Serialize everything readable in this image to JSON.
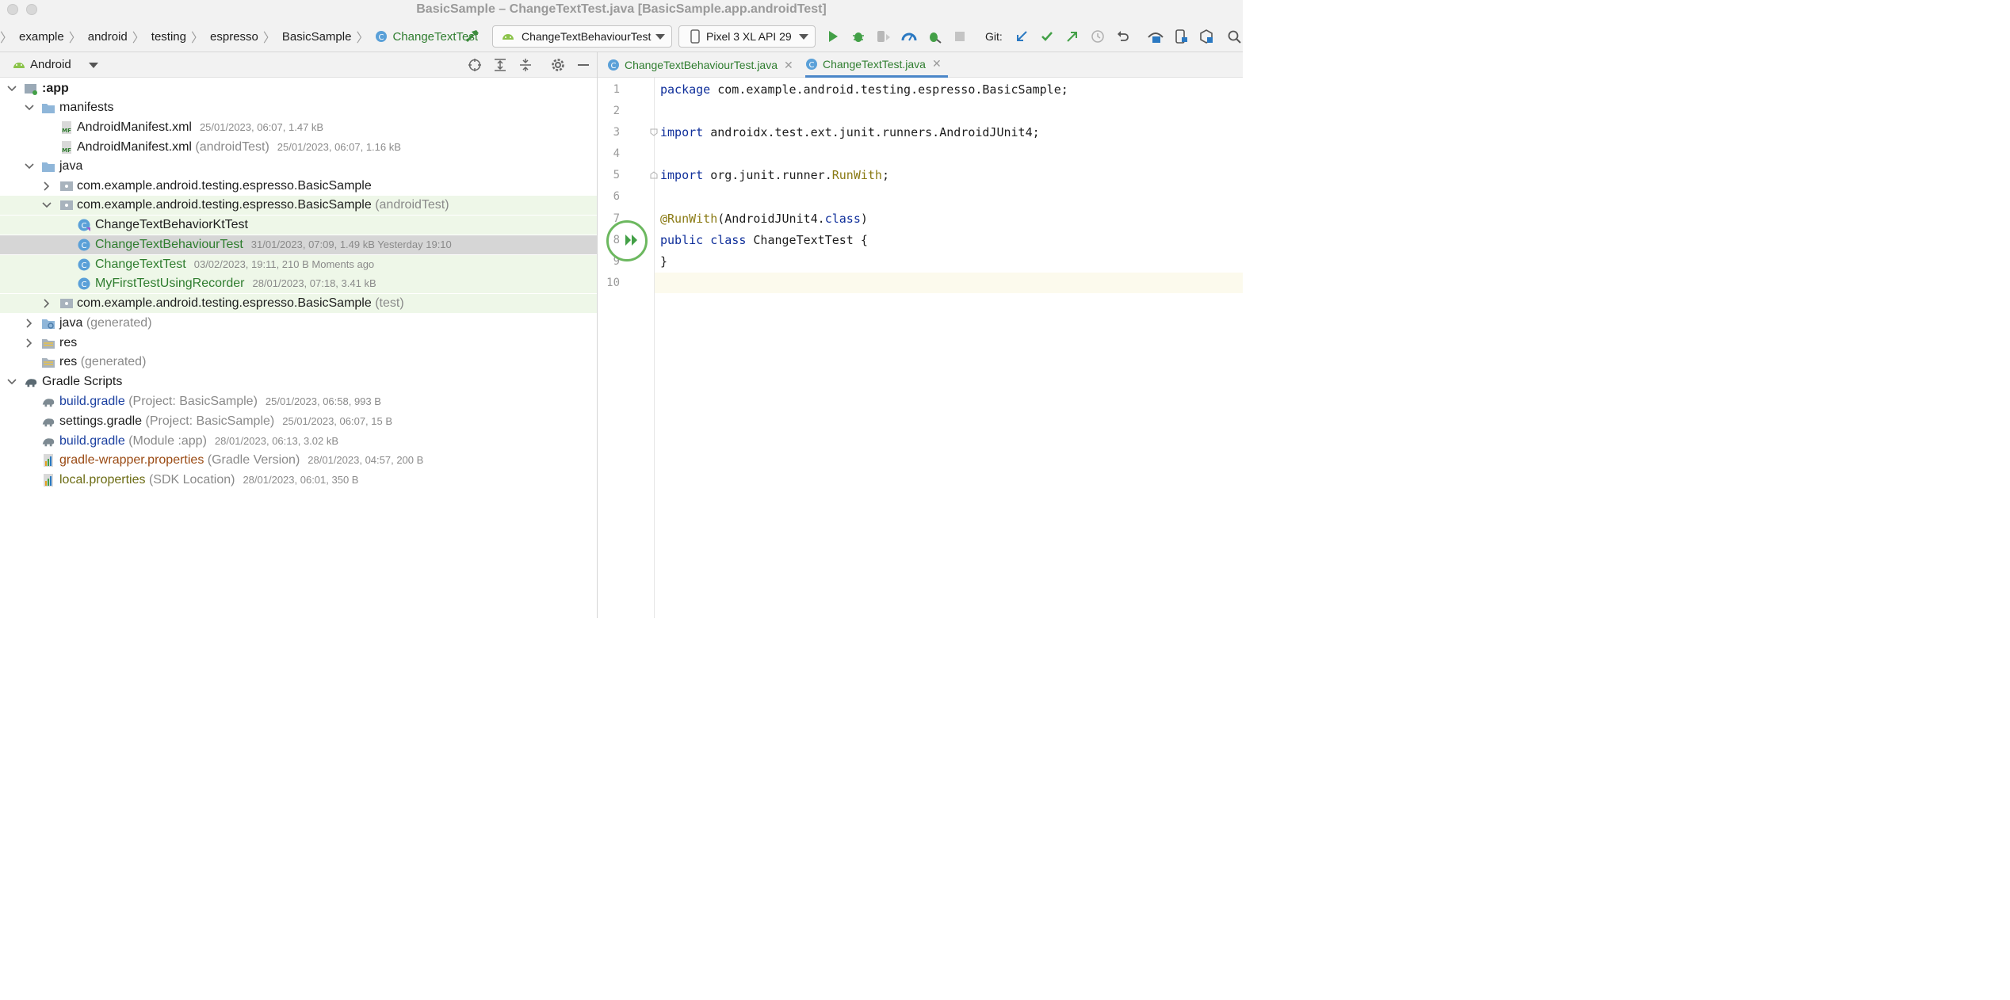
{
  "window": {
    "title": "BasicSample – ChangeTextTest.java [BasicSample.app.androidTest]"
  },
  "breadcrumb": [
    "example",
    "android",
    "testing",
    "espresso",
    "BasicSample",
    "ChangeTextTest"
  ],
  "toolbar": {
    "run_config": "ChangeTextBehaviourTest",
    "device": "Pixel 3 XL API 29",
    "git_label": "Git:"
  },
  "project_panel": {
    "view_mode": "Android"
  },
  "tree": {
    "app": ":app",
    "manifests": "manifests",
    "manifest1": {
      "name": "AndroidManifest.xml",
      "meta": "25/01/2023, 06:07, 1.47 kB"
    },
    "manifest2": {
      "name": "AndroidManifest.xml",
      "qual": "(androidTest)",
      "meta": "25/01/2023, 06:07, 1.16 kB"
    },
    "java": "java",
    "pkg_main": "com.example.android.testing.espresso.BasicSample",
    "pkg_android_test": {
      "name": "com.example.android.testing.espresso.BasicSample",
      "qual": "(androidTest)"
    },
    "file1": {
      "name": "ChangeTextBehaviorKtTest"
    },
    "file2": {
      "name": "ChangeTextBehaviourTest",
      "meta": "31/01/2023, 07:09, 1.49 kB Yesterday 19:10"
    },
    "file3": {
      "name": "ChangeTextTest",
      "meta": "03/02/2023, 19:11, 210 B Moments ago"
    },
    "file4": {
      "name": "MyFirstTestUsingRecorder",
      "meta": "28/01/2023, 07:18, 3.41 kB"
    },
    "pkg_test": {
      "name": "com.example.android.testing.espresso.BasicSample",
      "qual": "(test)"
    },
    "java_gen": {
      "name": "java",
      "qual": "(generated)"
    },
    "res": "res",
    "res_gen": {
      "name": "res",
      "qual": "(generated)"
    },
    "gradle_scripts": "Gradle Scripts",
    "g1": {
      "name": "build.gradle",
      "qual": "(Project: BasicSample)",
      "meta": "25/01/2023, 06:58, 993 B"
    },
    "g2": {
      "name": "settings.gradle",
      "qual": "(Project: BasicSample)",
      "meta": "25/01/2023, 06:07, 15 B"
    },
    "g3": {
      "name": "build.gradle",
      "qual": "(Module :app)",
      "meta": "28/01/2023, 06:13, 3.02 kB"
    },
    "g4": {
      "name": "gradle-wrapper.properties",
      "qual": "(Gradle Version)",
      "meta": "28/01/2023, 04:57, 200 B"
    },
    "g5": {
      "name": "local.properties",
      "qual": "(SDK Location)",
      "meta": "28/01/2023, 06:01, 350 B"
    }
  },
  "tabs": [
    {
      "label": "ChangeTextBehaviourTest.java"
    },
    {
      "label": "ChangeTextTest.java"
    }
  ],
  "editor": {
    "line_numbers": [
      "1",
      "2",
      "3",
      "4",
      "5",
      "6",
      "7",
      "8",
      "9",
      "10"
    ],
    "l1_kw": "package",
    "l1_rest": " com.example.android.testing.espresso.BasicSample;",
    "l3_kw": "import",
    "l3_rest": " androidx.test.ext.junit.runners.AndroidJUnit4;",
    "l5_kw": "import",
    "l5_rest": " org.junit.runner.",
    "l5_ann": "RunWith",
    "l5_end": ";",
    "l7_ann": "@RunWith",
    "l7_a": "(AndroidJUnit4.",
    "l7_kw": "class",
    "l7_b": ")",
    "l8_kw1": "public",
    "l8_kw2": "class",
    "l8_rest": " ChangeTextTest {",
    "l9": "}"
  },
  "colors": {
    "accent_green": "#6cb85f",
    "selected_row": "#d6d6d6",
    "highlight_row": "#eef7e8",
    "tab_active": "#4a86c8"
  }
}
